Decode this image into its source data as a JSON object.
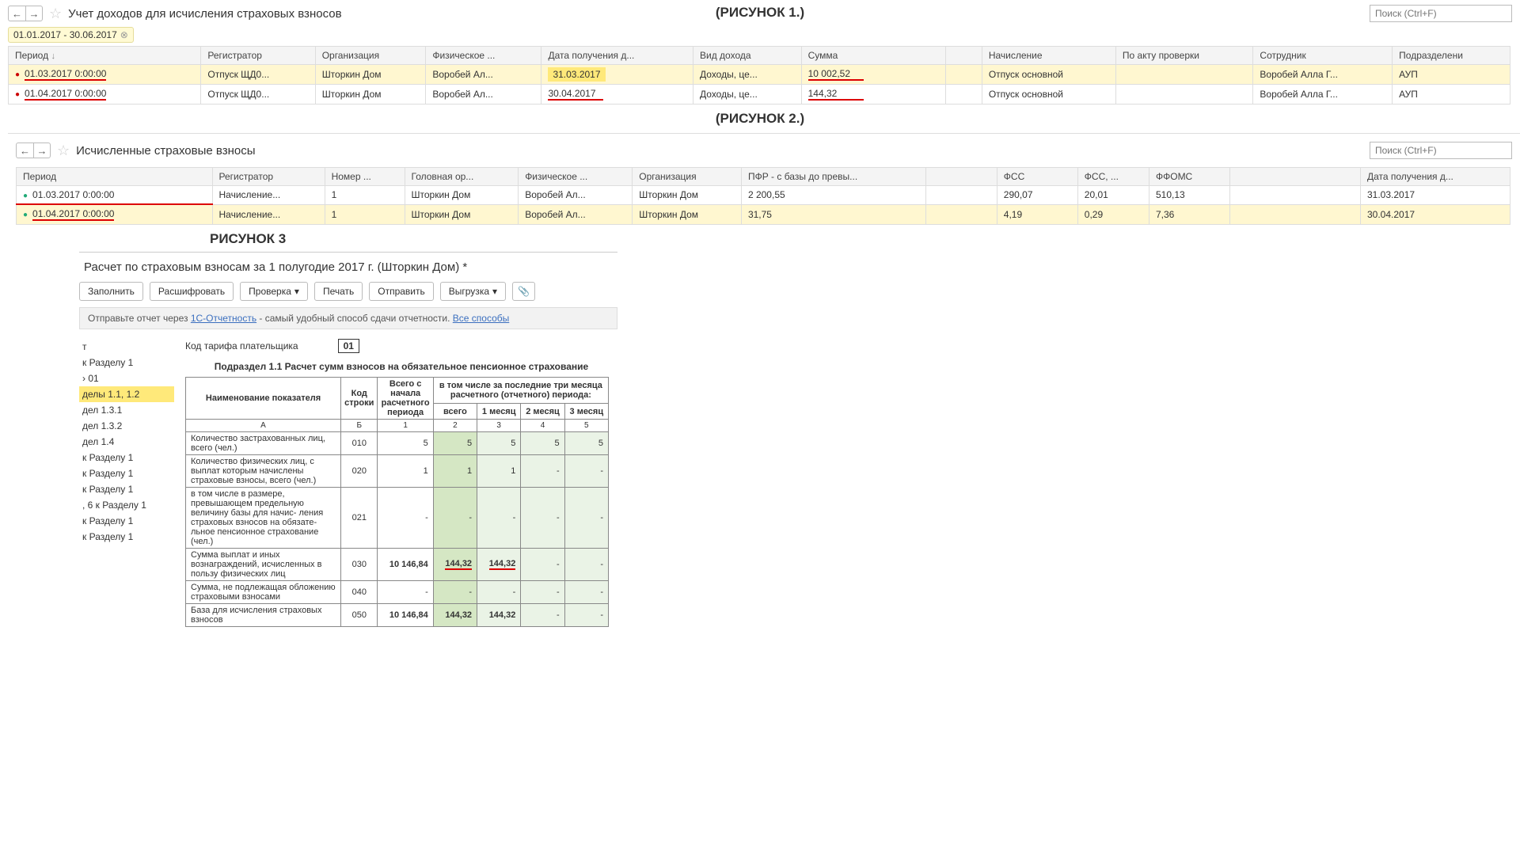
{
  "fig1": {
    "title": "Учет доходов для исчисления страховых взносов",
    "search_placeholder": "Поиск (Ctrl+F)",
    "badge": "01.01.2017 - 30.06.2017",
    "caption": "(РИСУНОК 1.)",
    "columns": [
      "Период",
      "Регистратор",
      "Организация",
      "Физическое ...",
      "Дата получения д...",
      "Вид дохода",
      "Сумма",
      "",
      "Начисление",
      "По акту проверки",
      "Сотрудник",
      "Подразделени"
    ],
    "rows": [
      {
        "period": "01.03.2017 0:00:00",
        "reg": "Отпуск ЩД0...",
        "org": "Шторкин Дом",
        "phys": "Воробей Ал...",
        "date": "31.03.2017",
        "type": "Доходы, це...",
        "sum": "10 002,52",
        "acc": "Отпуск основной",
        "emp": "Воробей Алла Г...",
        "dep": "АУП",
        "hl": true,
        "date_hl": true
      },
      {
        "period": "01.04.2017 0:00:00",
        "reg": "Отпуск ЩД0...",
        "org": "Шторкин Дом",
        "phys": "Воробей Ал...",
        "date": "30.04.2017",
        "type": "Доходы, це...",
        "sum": "144,32",
        "acc": "Отпуск основной",
        "emp": "Воробей Алла Г...",
        "dep": "АУП",
        "hl": false
      }
    ]
  },
  "fig2": {
    "title": "Исчисленные страховые взносы",
    "search_placeholder": "Поиск (Ctrl+F)",
    "caption": "(РИСУНОК 2.)",
    "columns": [
      "Период",
      "Регистратор",
      "Номер ...",
      "Головная ор...",
      "Физическое ...",
      "Организация",
      "ПФР - с базы до превы...",
      "",
      "ФСС",
      "ФСС, ...",
      "ФФОМС",
      "",
      "Дата получения д..."
    ],
    "rows": [
      {
        "period": "01.03.2017 0:00:00",
        "reg": "Начисление...",
        "num": "1",
        "head": "Шторкин Дом",
        "phys": "Воробей Ал...",
        "org": "Шторкин Дом",
        "pfr": "2 200,55",
        "fss": "290,07",
        "fss2": "20,01",
        "ffoms": "510,13",
        "date": "31.03.2017",
        "hl": false
      },
      {
        "period": "01.04.2017 0:00:00",
        "reg": "Начисление...",
        "num": "1",
        "head": "Шторкин Дом",
        "phys": "Воробей Ал...",
        "org": "Шторкин Дом",
        "pfr": "31,75",
        "fss": "4,19",
        "fss2": "0,29",
        "ffoms": "7,36",
        "date": "30.04.2017",
        "hl": true
      }
    ]
  },
  "fig3": {
    "caption": "РИСУНОК 3",
    "title": "Расчет по страховым взносам за 1 полугодие 2017 г. (Шторкин Дом) *",
    "buttons": {
      "fill": "Заполнить",
      "decode": "Расшифровать",
      "check": "Проверка",
      "print": "Печать",
      "send": "Отправить",
      "export": "Выгрузка",
      "attach": "📎"
    },
    "banner_prefix": "Отправьте отчет через ",
    "banner_link1": "1С-Отчетность",
    "banner_mid": " - самый удобный способ сдачи отчетности. ",
    "banner_link2": "Все способы",
    "side_items": [
      "т",
      "к Разделу 1",
      "› 01",
      "делы 1.1, 1.2",
      "дел 1.3.1",
      "дел 1.3.2",
      "дел 1.4",
      "к Разделу 1",
      "к Разделу 1",
      "к Разделу 1",
      ", 6 к Разделу 1",
      "к Разделу 1",
      "к Разделу 1"
    ],
    "side_selected_index": 3,
    "tariff_label": "Код тарифа плательщика",
    "tariff_code": "01",
    "subhead": "Подраздел 1.1 Расчет сумм взносов на обязательное пенсионное страхование",
    "th_name": "Наименование показателя",
    "th_code": "Код строки",
    "th_total": "Всего с начала расчетного периода",
    "th_group": "в том числе за последние три месяца расчетного (отчетного) периода:",
    "th_vsego": "всего",
    "th_m1": "1 месяц",
    "th_m2": "2 месяц",
    "th_m3": "3 месяц",
    "colA": "А",
    "colB": "Б",
    "col1": "1",
    "col2": "2",
    "col3": "3",
    "col4": "4",
    "col5": "5",
    "rows": [
      {
        "name": "Количество застрахованных лиц, всего (чел.)",
        "code": "010",
        "v1": "5",
        "v2": "5",
        "v3": "5",
        "v4": "5",
        "v5": "5"
      },
      {
        "name": "Количество физических лиц, с выплат которым начислены страховые взносы, всего (чел.)",
        "code": "020",
        "v1": "1",
        "v2": "1",
        "v3": "1",
        "v4": "-",
        "v5": "-"
      },
      {
        "name": "   в том числе в размере, превышающем предельную величину базы для начис- ления страховых взносов на обязате- льное пенсионное страхование (чел.)",
        "code": "021",
        "v1": "-",
        "v2": "-",
        "v3": "-",
        "v4": "-",
        "v5": "-"
      },
      {
        "name": "Сумма выплат и иных вознаграждений, исчисленных в пользу физических лиц",
        "code": "030",
        "v1": "10 146,84",
        "v2": "144,32",
        "v3": "144,32",
        "v4": "-",
        "v5": "-",
        "bold": true,
        "ul": true
      },
      {
        "name": "Сумма, не подлежащая обложению страховыми взносами",
        "code": "040",
        "v1": "-",
        "v2": "-",
        "v3": "-",
        "v4": "-",
        "v5": "-"
      },
      {
        "name": "База для исчисления страховых взносов",
        "code": "050",
        "v1": "10 146,84",
        "v2": "144,32",
        "v3": "144,32",
        "v4": "-",
        "v5": "-",
        "bold": true
      }
    ]
  }
}
